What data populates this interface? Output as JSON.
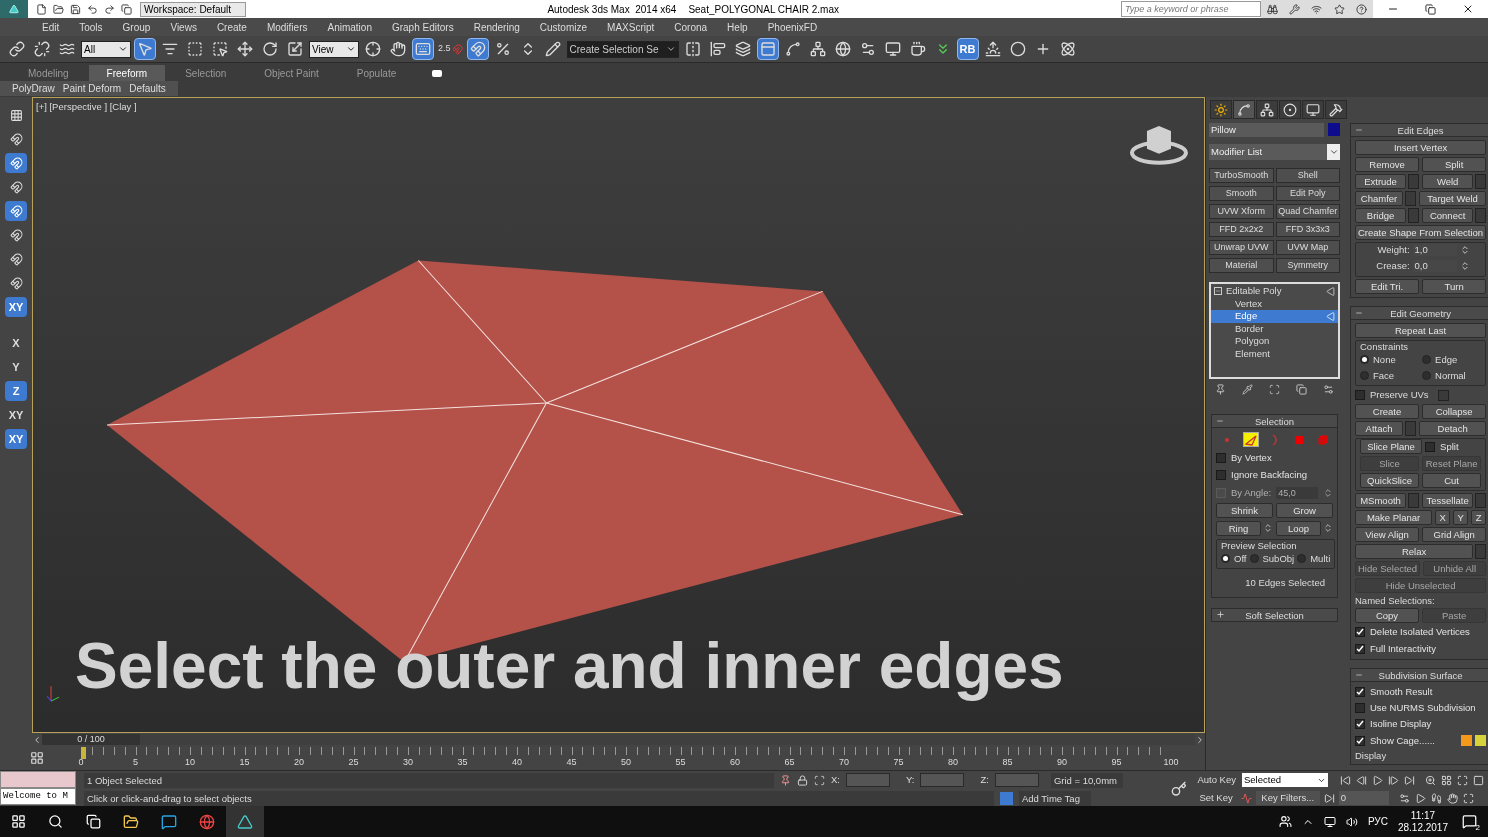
{
  "title_bar": {
    "workspace": "Workspace: Default",
    "app": "Autodesk 3ds Max  2014 x64",
    "file": "Seat_POLYGONAL CHAIR 2.max",
    "search_placeholder": "Type a keyword or phrase"
  },
  "menu": [
    "Edit",
    "Tools",
    "Group",
    "Views",
    "Create",
    "Modifiers",
    "Animation",
    "Graph Editors",
    "Rendering",
    "Customize",
    "MAXScript",
    "Corona",
    "Help",
    "PhoenixFD"
  ],
  "toolbar": [
    {
      "kind": "link",
      "on": false
    },
    {
      "kind": "unlink",
      "on": false
    },
    {
      "kind": "bind",
      "on": false
    },
    {
      "kind": "dropdown",
      "value": "All"
    },
    {
      "kind": "select",
      "on": true
    },
    {
      "kind": "select_name",
      "on": false
    },
    {
      "kind": "region",
      "on": false
    },
    {
      "kind": "crossing",
      "on": false
    },
    {
      "kind": "move",
      "on": false
    },
    {
      "kind": "rotate",
      "on": false
    },
    {
      "kind": "scale",
      "on": false
    },
    {
      "kind": "dropdown",
      "value": "View"
    },
    {
      "kind": "pivot",
      "on": false
    },
    {
      "kind": "manipulate",
      "on": false
    },
    {
      "kind": "keyboard",
      "on": true
    },
    {
      "kind": "snap",
      "on": false,
      "label": "2.5"
    },
    {
      "kind": "angle_snap",
      "on": true
    },
    {
      "kind": "percent",
      "on": false
    },
    {
      "kind": "spinner_snap",
      "on": false
    },
    {
      "kind": "named_edit",
      "on": false
    },
    {
      "kind": "dropdown_dark",
      "value": "Create Selection Se"
    },
    {
      "kind": "mirror",
      "on": false
    },
    {
      "kind": "align",
      "on": false
    },
    {
      "kind": "layers",
      "on": false
    },
    {
      "kind": "ribbon",
      "on": true
    },
    {
      "kind": "curve",
      "on": false
    },
    {
      "kind": "schematic",
      "on": false
    },
    {
      "kind": "material",
      "on": false
    },
    {
      "kind": "render_setup",
      "on": false
    },
    {
      "kind": "render_frame",
      "on": false
    },
    {
      "kind": "render",
      "on": false
    },
    {
      "kind": "chevrons",
      "on": false
    },
    {
      "kind": "rb",
      "on": true,
      "label": "RB"
    },
    {
      "kind": "environment",
      "on": false
    },
    {
      "kind": "sphere",
      "on": false
    },
    {
      "kind": "plus",
      "on": false
    },
    {
      "kind": "particles",
      "on": false
    }
  ],
  "ribbon_tabs": [
    {
      "label": "Modeling",
      "selected": false
    },
    {
      "label": "Freeform",
      "selected": true
    },
    {
      "label": "Selection",
      "selected": false
    },
    {
      "label": "Object Paint",
      "selected": false
    },
    {
      "label": "Populate",
      "selected": false
    }
  ],
  "ribbon_subtabs": [
    "PolyDraw",
    "Paint Deform",
    "Defaults"
  ],
  "left_toolbar": [
    {
      "kind": "grid",
      "on": false
    },
    {
      "kind": "snap",
      "on": false
    },
    {
      "kind": "snap",
      "on": true
    },
    {
      "kind": "snap",
      "on": false
    },
    {
      "kind": "snap",
      "on": true
    },
    {
      "kind": "snap",
      "on": false
    },
    {
      "kind": "snap",
      "on": false
    },
    {
      "kind": "snap",
      "on": false
    },
    {
      "kind": "axis",
      "on": true,
      "label": "XY"
    },
    {
      "kind": "axis",
      "on": false,
      "label": "X"
    },
    {
      "kind": "axis",
      "on": false,
      "label": "Y"
    },
    {
      "kind": "axis",
      "on": true,
      "label": "Z"
    },
    {
      "kind": "axis",
      "on": false,
      "label": "XY"
    },
    {
      "kind": "axis",
      "on": true,
      "label": "XY"
    }
  ],
  "viewport": {
    "label": "[+] [Perspective ] [Clay ]",
    "caption": "Select the outer and inner edges"
  },
  "command_panel": {
    "tabs": [
      {
        "kind": "create",
        "selected": false
      },
      {
        "kind": "modify",
        "selected": true
      },
      {
        "kind": "hierarchy",
        "selected": false
      },
      {
        "kind": "motion",
        "selected": false
      },
      {
        "kind": "display",
        "selected": false
      },
      {
        "kind": "utilities",
        "selected": false
      }
    ],
    "object": {
      "name": "Pillow",
      "color": "#0c0c8c"
    },
    "modifier_list": "Modifier List",
    "modifier_buttons": [
      "TurboSmooth",
      "Shell",
      "Smooth",
      "Edit Poly",
      "UVW Xform",
      "Quad Chamfer",
      "FFD 2x2x2",
      "FFD 3x3x3",
      "Unwrap UVW",
      "UVW Map",
      "Material",
      "Symmetry"
    ],
    "stack": [
      {
        "label": "Editable Poly",
        "expanded": true,
        "selected": false,
        "children": [
          {
            "label": "Vertex",
            "selected": false
          },
          {
            "label": "Edge",
            "selected": true
          },
          {
            "label": "Border",
            "selected": false
          },
          {
            "label": "Polygon",
            "selected": false
          },
          {
            "label": "Element",
            "selected": false
          }
        ]
      }
    ],
    "left_rollouts": [
      {
        "title": "Selection",
        "expanded": true,
        "rows": [
          [
            {
              "kind": "levels",
              "items": [
                {
                  "kind": "vertex",
                  "selected": false
                },
                {
                  "kind": "edge",
                  "selected": true
                },
                {
                  "kind": "border",
                  "selected": false
                },
                {
                  "kind": "polygon",
                  "selected": false
                },
                {
                  "kind": "element",
                  "selected": false
                }
              ]
            }
          ],
          [
            {
              "kind": "checkbox",
              "label": "By Vertex",
              "checked": false,
              "disabled": false
            }
          ],
          [
            {
              "kind": "checkbox",
              "label": "Ignore Backfacing",
              "checked": false,
              "disabled": false
            }
          ],
          [
            {
              "kind": "checkbox_value",
              "label": "By Angle:",
              "value": "45,0",
              "checked": false,
              "disabled": true
            }
          ],
          [
            {
              "kind": "button",
              "label": "Shrink",
              "disabled": false
            },
            {
              "kind": "button",
              "label": "Grow",
              "disabled": false
            }
          ],
          [
            {
              "kind": "button_spin",
              "label": "Ring",
              "disabled": false
            },
            {
              "kind": "button_spin",
              "label": "Loop",
              "disabled": false
            }
          ],
          [
            {
              "kind": "group",
              "title": "Preview Selection",
              "rows": [
                [
                  {
                    "kind": "radio",
                    "label": "Off",
                    "selected": true
                  },
                  {
                    "kind": "radio",
                    "label": "SubObj",
                    "selected": false
                  },
                  {
                    "kind": "radio",
                    "label": "Multi",
                    "selected": false
                  }
                ]
              ]
            }
          ],
          [
            {
              "kind": "status",
              "label": "10 Edges Selected"
            }
          ]
        ]
      },
      {
        "title": "Soft Selection",
        "expanded": false
      }
    ],
    "right_rollouts": [
      {
        "title": "Edit Edges",
        "expanded": true,
        "rows": [
          [
            {
              "kind": "button",
              "label": "Insert Vertex",
              "disabled": false
            }
          ],
          [
            {
              "kind": "button",
              "label": "Remove",
              "disabled": false
            },
            {
              "kind": "button",
              "label": "Split",
              "disabled": false
            }
          ],
          [
            {
              "kind": "button_opt",
              "label": "Extrude",
              "disabled": false
            },
            {
              "kind": "button_opt",
              "label": "Weld",
              "disabled": false
            }
          ],
          [
            {
              "kind": "button_opt",
              "label": "Chamfer",
              "disabled": false
            },
            {
              "kind": "button",
              "label": "Target Weld",
              "disabled": false
            }
          ],
          [
            {
              "kind": "button_opt",
              "label": "Bridge",
              "disabled": false
            },
            {
              "kind": "button_opt",
              "label": "Connect",
              "disabled": false
            }
          ],
          [
            {
              "kind": "button",
              "label": "Create Shape From Selection",
              "disabled": false
            }
          ],
          [
            {
              "kind": "group",
              "rows": [
                [
                  {
                    "kind": "spinner",
                    "label": "Weight:",
                    "value": "1,0"
                  }
                ],
                [
                  {
                    "kind": "spinner",
                    "label": "Crease:",
                    "value": "0,0"
                  }
                ]
              ]
            }
          ],
          [
            {
              "kind": "button",
              "label": "Edit Tri.",
              "disabled": false
            },
            {
              "kind": "button",
              "label": "Turn",
              "disabled": false
            }
          ]
        ]
      },
      {
        "title": "Edit Geometry",
        "expanded": true,
        "rows": [
          [
            {
              "kind": "button",
              "label": "Repeat Last",
              "disabled": false
            }
          ],
          [
            {
              "kind": "group",
              "title": "Constraints",
              "rows": [
                [
                  {
                    "kind": "radio",
                    "label": "None",
                    "selected": true
                  },
                  {
                    "kind": "radio",
                    "label": "Edge",
                    "selected": false
                  }
                ],
                [
                  {
                    "kind": "radio",
                    "label": "Face",
                    "selected": false
                  },
                  {
                    "kind": "radio",
                    "label": "Normal",
                    "selected": false
                  }
                ]
              ]
            }
          ],
          [
            {
              "kind": "checkbox_opt",
              "label": "Preserve UVs",
              "checked": false,
              "disabled": false
            }
          ],
          [
            {
              "kind": "button",
              "label": "Create",
              "disabled": false
            },
            {
              "kind": "button",
              "label": "Collapse",
              "disabled": false
            }
          ],
          [
            {
              "kind": "button_opt",
              "label": "Attach",
              "disabled": false
            },
            {
              "kind": "button",
              "label": "Detach",
              "disabled": false
            }
          ],
          [
            {
              "kind": "group",
              "rows": [
                [
                  {
                    "kind": "button",
                    "label": "Slice Plane",
                    "disabled": false
                  },
                  {
                    "kind": "checkbox",
                    "label": "Split",
                    "checked": false,
                    "disabled": false
                  }
                ],
                [
                  {
                    "kind": "button",
                    "label": "Slice",
                    "disabled": true
                  },
                  {
                    "kind": "button",
                    "label": "Reset Plane",
                    "disabled": true
                  }
                ],
                [
                  {
                    "kind": "button",
                    "label": "QuickSlice",
                    "disabled": false
                  },
                  {
                    "kind": "button",
                    "label": "Cut",
                    "disabled": false
                  }
                ]
              ]
            }
          ],
          [
            {
              "kind": "button_opt",
              "label": "MSmooth",
              "disabled": false
            },
            {
              "kind": "button_opt",
              "label": "Tessellate",
              "disabled": false
            }
          ],
          [
            {
              "kind": "button",
              "label": "Make Planar",
              "disabled": false
            },
            {
              "kind": "small_button",
              "label": "X",
              "disabled": false
            },
            {
              "kind": "small_button",
              "label": "Y",
              "disabled": false
            },
            {
              "kind": "small_button",
              "label": "Z",
              "disabled": false
            }
          ],
          [
            {
              "kind": "button",
              "label": "View Align",
              "disabled": false
            },
            {
              "kind": "button",
              "label": "Grid Align",
              "disabled": false
            }
          ],
          [
            {
              "kind": "button_opt",
              "label": "Relax",
              "disabled": false
            }
          ],
          [
            {
              "kind": "button",
              "label": "Hide Selected",
              "disabled": true
            },
            {
              "kind": "button",
              "label": "Unhide All",
              "disabled": true
            }
          ],
          [
            {
              "kind": "button",
              "label": "Hide Unselected",
              "disabled": true
            }
          ],
          [
            {
              "kind": "label",
              "label": "Named Selections:"
            }
          ],
          [
            {
              "kind": "button",
              "label": "Copy",
              "disabled": false
            },
            {
              "kind": "button",
              "label": "Paste",
              "disabled": true
            }
          ],
          [
            {
              "kind": "checkbox",
              "label": "Delete Isolated Vertices",
              "checked": true,
              "disabled": false
            }
          ],
          [
            {
              "kind": "checkbox",
              "label": "Full Interactivity",
              "checked": true,
              "disabled": false
            }
          ]
        ]
      },
      {
        "title": "Subdivision Surface",
        "expanded": true,
        "rows": [
          [
            {
              "kind": "checkbox",
              "label": "Smooth Result",
              "checked": true,
              "disabled": false
            }
          ],
          [
            {
              "kind": "checkbox",
              "label": "Use NURMS Subdivision",
              "checked": false,
              "disabled": false
            }
          ],
          [
            {
              "kind": "checkbox",
              "label": "Isoline Display",
              "checked": true,
              "disabled": false
            }
          ],
          [
            {
              "kind": "checkbox",
              "label": "Show Cage......",
              "checked": true,
              "disabled": false
            },
            {
              "kind": "swatch",
              "color": "#f39a1c"
            },
            {
              "kind": "swatch",
              "color": "#d8d23a"
            }
          ],
          [
            {
              "kind": "label",
              "label": "Display"
            }
          ]
        ]
      }
    ]
  },
  "time_slider": {
    "value": "0 / 100",
    "level": 0
  },
  "frame_labels": [
    "0",
    "5",
    "10",
    "15",
    "20",
    "25",
    "30",
    "35",
    "40",
    "45",
    "50",
    "55",
    "60",
    "65",
    "70",
    "75",
    "80",
    "85",
    "90",
    "95",
    "100"
  ],
  "status": {
    "listener": "Welcome to M",
    "selection": "1 Object Selected",
    "prompt": "Click or click-and-drag to select objects",
    "x_label": "X:",
    "y_label": "Y:",
    "z_label": "Z:",
    "grid": "Grid = 10,0mm",
    "time_tag": "Add Time Tag",
    "auto_key": "Auto Key",
    "set_key": "Set Key",
    "key_mode": "Selected",
    "key_filters": "Key Filters...",
    "frame": "0"
  },
  "taskbar": {
    "language": "РУС",
    "time": "11:17",
    "date": "28.12.2017",
    "notifications": "2"
  }
}
